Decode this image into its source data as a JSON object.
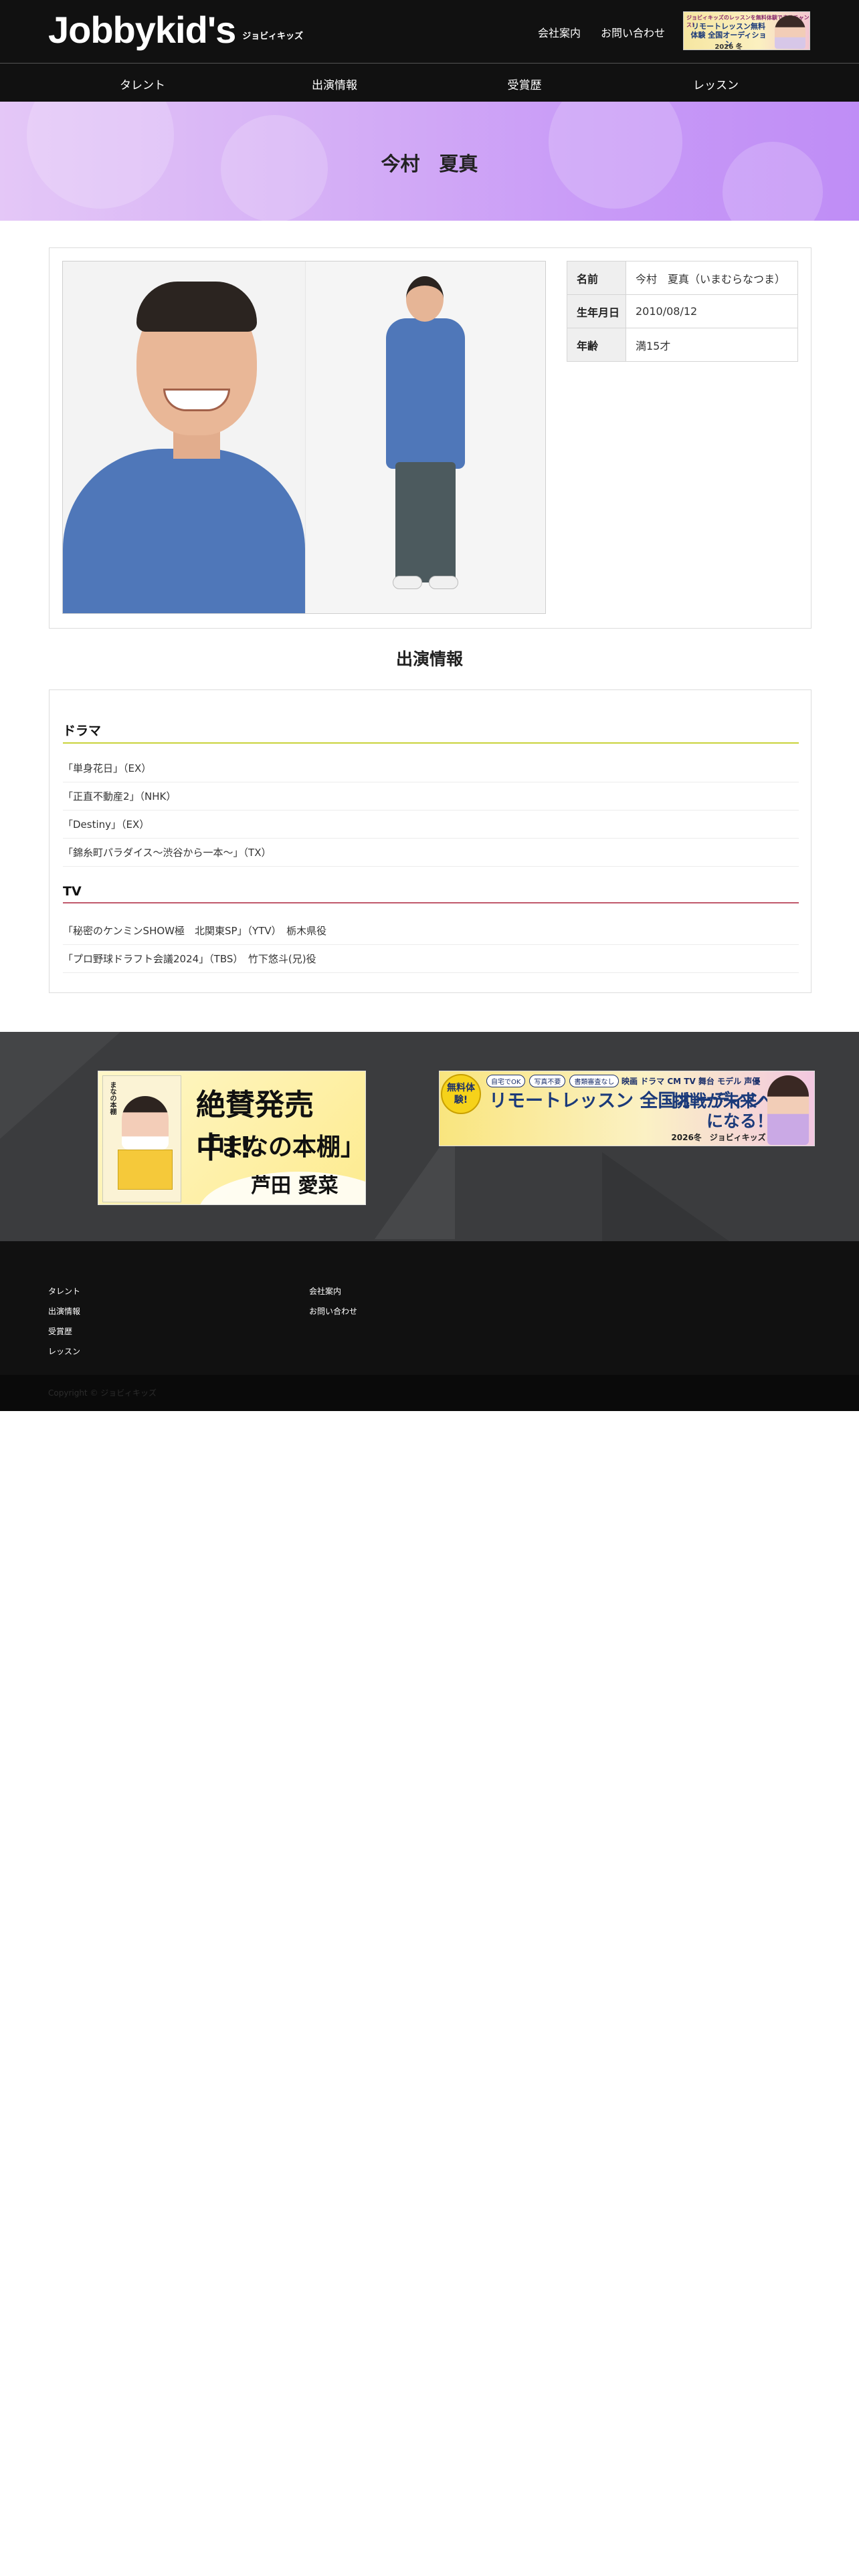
{
  "header": {
    "logo_text": "Jobbykid's",
    "logo_sub": "ジョビィキッズ",
    "links": [
      "会社案内",
      "お問い合わせ"
    ],
    "banner": {
      "top_text": "ジョビィキッズのレッスンを無料体験できるチャンス！",
      "main_text": "リモートレッスン無料体験 全国オーディション",
      "year": "2026 冬"
    }
  },
  "nav": {
    "items": [
      "タレント",
      "出演情報",
      "受賞歴",
      "レッスン"
    ]
  },
  "hero": {
    "title": "今村　夏真"
  },
  "profile": {
    "rows": [
      {
        "label": "名前",
        "value": "今村　夏真（いまむらなつま）"
      },
      {
        "label": "生年月日",
        "value": "2010/08/12"
      },
      {
        "label": "年齢",
        "value": "満15才"
      }
    ]
  },
  "appearance": {
    "title": "出演情報",
    "drama": {
      "label": "ドラマ",
      "items": [
        "「単身花日」（EX）",
        "「正直不動産2」（NHK）",
        "「Destiny」（EX）",
        "「錦糸町パラダイス〜渋谷から一本〜」（TX）"
      ]
    },
    "tv": {
      "label": "TV",
      "items": [
        "「秘密のケンミンSHOW極　北関東SP」（YTV）　栃木県役",
        "「プロ野球ドラフト会議2024」（TBS）　竹下悠斗(兄)役"
      ]
    }
  },
  "banners": {
    "book": {
      "cover_title": "まなの本棚",
      "line1": "絶賛発売中!!",
      "line2": "「まなの本棚」",
      "line3": "芦田 愛菜"
    },
    "remote": {
      "badge": "無料体験!",
      "tags": [
        "自宅でOK",
        "写真不要",
        "書類審査なし"
      ],
      "tag2": "映画 ドラマ CM TV 舞台 モデル 声優",
      "main": "リモートレッスン 全国オーディション",
      "right": "挑戦が未来への力になる！",
      "year": "2026冬　ジョビィキッズ"
    }
  },
  "footer": {
    "col1": [
      "タレント",
      "出演情報",
      "受賞歴",
      "レッスン"
    ],
    "col2": [
      "会社案内",
      "お問い合わせ"
    ],
    "copyright": "Copyright © ジョビィキッズ"
  },
  "colors": {
    "header_bg": "#111111",
    "hero_gradient_start": "#e4c7f7",
    "hero_gradient_end": "#bf8df6",
    "drama_underline": "#c9d33a",
    "tv_underline": "#c0586b",
    "band_bg": "#3b3c3e"
  }
}
